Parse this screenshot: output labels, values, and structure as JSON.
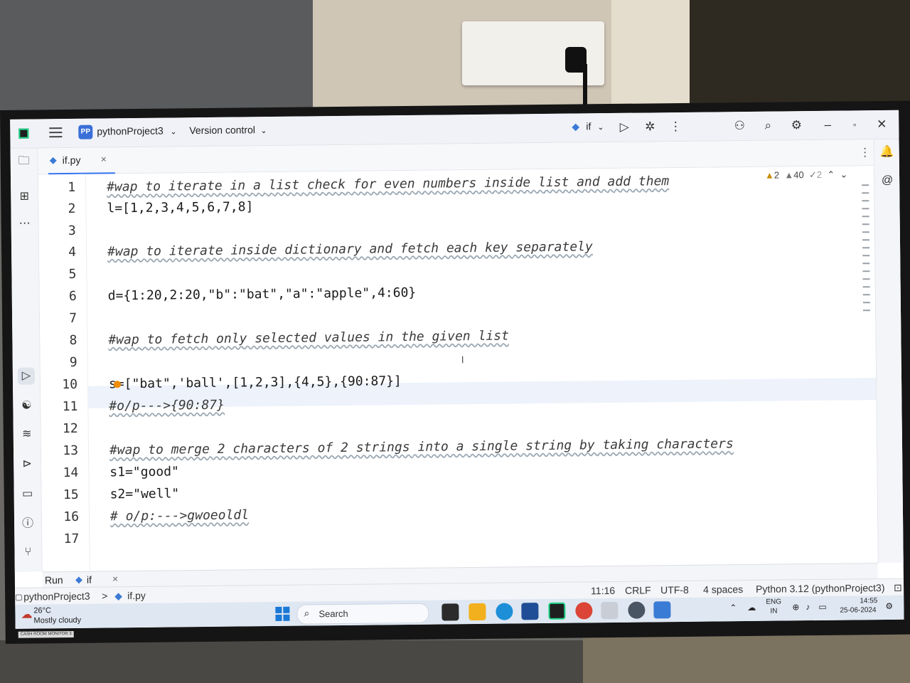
{
  "titlebar": {
    "project_badge": "PP",
    "project_name": "pythonProject3",
    "version_control": "Version control",
    "run_config": "if"
  },
  "tab": {
    "filename": "if.py",
    "close": "×"
  },
  "inspections": {
    "warnings": "2",
    "weak_warnings": "40",
    "typos": "2"
  },
  "editor": {
    "line_numbers": [
      "1",
      "2",
      "3",
      "4",
      "5",
      "6",
      "7",
      "8",
      "9",
      "10",
      "11",
      "12",
      "13",
      "14",
      "15",
      "16",
      "17"
    ],
    "lines": [
      "#wap to iterate in a list check for even numbers inside list and add them",
      "l=[1,2,3,4,5,6,7,8]",
      "",
      "#wap to iterate inside dictionary and fetch each key separately",
      "",
      "d={1:20,2:20,\"b\":\"bat\",\"a\":\"apple\",4:60}",
      "",
      "#wap to fetch only selected values in the given list",
      "",
      "s=[\"bat\",'ball',[1,2,3],{4,5},{90:87}]",
      "#o/p--->{90:87}",
      "",
      "#wap to merge 2 characters of 2 strings into a single string by taking characters",
      "s1=\"good\"",
      "s2=\"well\"",
      "# o/p:--->gwoeoldl",
      ""
    ]
  },
  "run_panel": {
    "label": "Run",
    "tab": "if",
    "close": "×"
  },
  "statusbar": {
    "breadcrumb_project": "pythonProject3",
    "breadcrumb_sep": ">",
    "breadcrumb_file": "if.py",
    "position": "11:16",
    "line_sep": "CRLF",
    "encoding": "UTF-8",
    "indent": "4 spaces",
    "interpreter": "Python 3.12 (pythonProject3)"
  },
  "taskbar": {
    "weather_temp": "26°C",
    "weather_desc": "Mostly cloudy",
    "search_placeholder": "Search",
    "lang_line1": "ENG",
    "lang_line2": "IN",
    "time": "14:55",
    "date": "25-06-2024"
  },
  "monitor_sticker": "CASH ROOM MONITOR 3"
}
